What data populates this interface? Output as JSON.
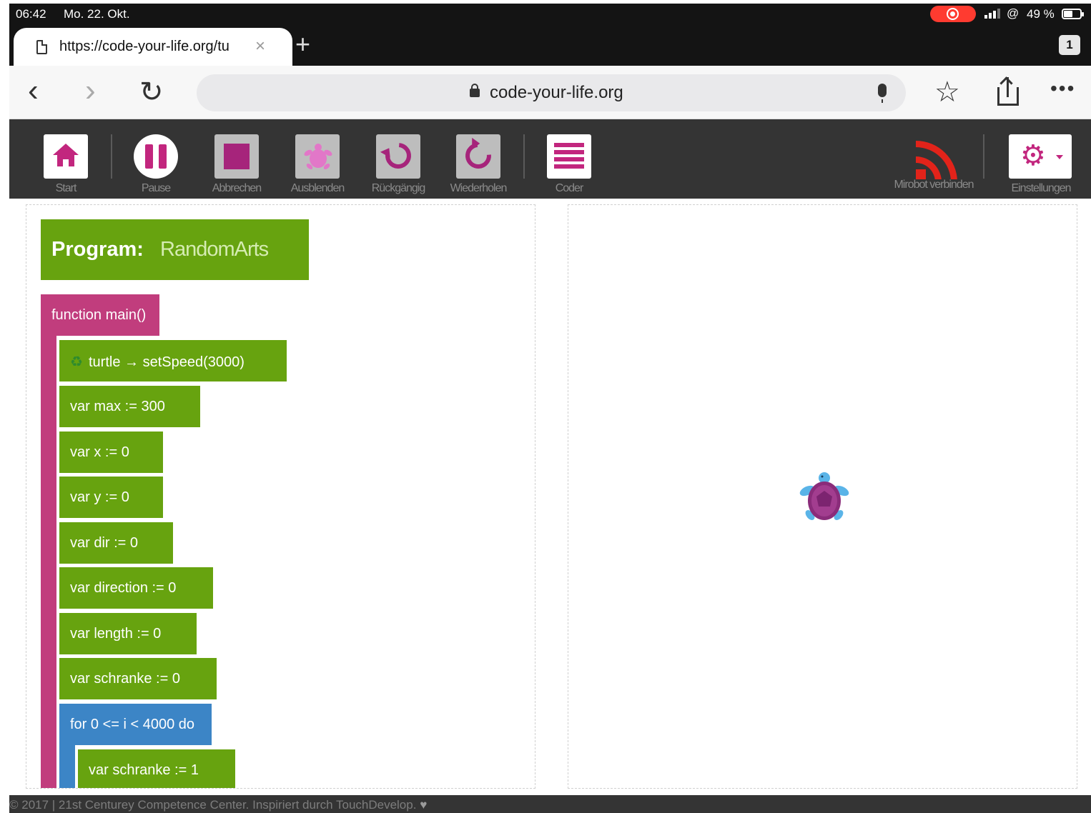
{
  "status_bar": {
    "time": "06:42",
    "date": "Mo. 22. Okt.",
    "battery": "49 %"
  },
  "browser": {
    "tab_url": "https://code-your-life.org/tu",
    "tab_close": "×",
    "new_tab": "+",
    "tab_count": "1",
    "host": "code-your-life.org",
    "more": "•••"
  },
  "toolbar": {
    "start": "Start",
    "pause": "Pause",
    "abort": "Abbrechen",
    "hide": "Ausblenden",
    "undo": "Rückgängig",
    "redo": "Wiederholen",
    "coder": "Coder",
    "mirobot": "Mirobot verbinden",
    "settings": "Einstellungen"
  },
  "colors": {
    "accent": "#c2267e",
    "block_green": "#67a30f",
    "function_pink": "#c13d7d",
    "loop_blue": "#3c85c6",
    "mirobot_red": "#e2231a"
  },
  "program": {
    "keyword": "Program:",
    "name": "RandomArts",
    "function_header": "function main()",
    "statements": [
      "turtle → setSpeed(3000)",
      "var max := 300",
      "var x := 0",
      "var y := 0",
      "var dir := 0",
      "var direction := 0",
      "var length := 0",
      "var schranke := 0"
    ],
    "for_loop": "for 0 <= i < 4000 do",
    "loop_body": [
      "var schranke := 1"
    ]
  },
  "footer": {
    "text": "© 2017 | 21st Centurey Competence Center. Inspiriert durch TouchDevelop."
  }
}
